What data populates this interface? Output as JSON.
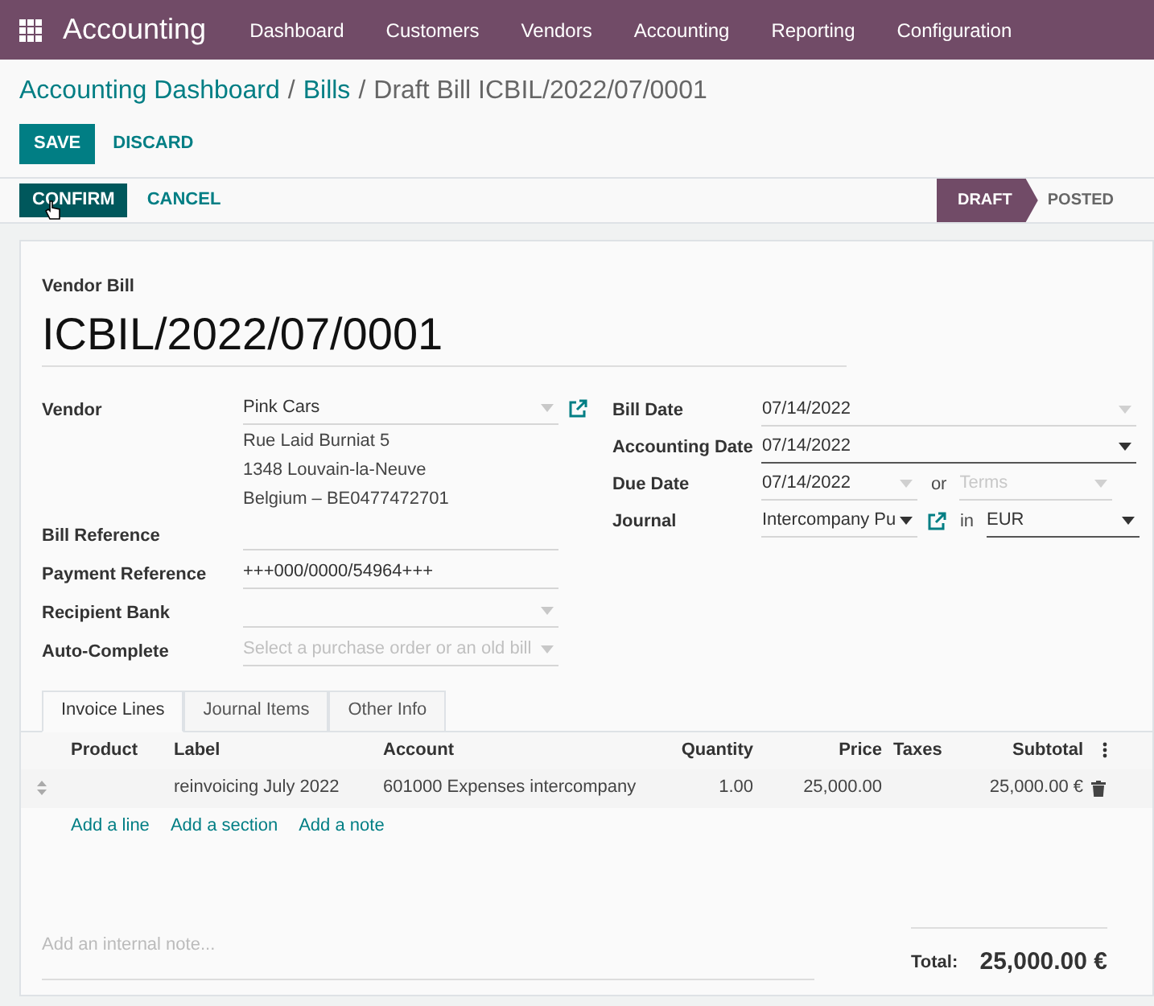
{
  "navbar": {
    "app": "Accounting",
    "menu": [
      "Dashboard",
      "Customers",
      "Vendors",
      "Accounting",
      "Reporting",
      "Configuration"
    ]
  },
  "breadcrumb": [
    {
      "label": "Accounting Dashboard",
      "link": true
    },
    {
      "label": "Bills",
      "link": true,
      "separator": "/"
    },
    {
      "label": "Draft Bill ICBIL/2022/07/0001",
      "link": false,
      "separator": "/"
    }
  ],
  "edit_buttons": [
    {
      "label": "SAVE",
      "kind": "primary"
    },
    {
      "label": "DISCARD",
      "kind": "link"
    }
  ],
  "action_buttons": [
    {
      "label": "CONFIRM",
      "kind": "primary"
    },
    {
      "label": "CANCEL",
      "kind": "link"
    }
  ],
  "statusbar": [
    {
      "label": "DRAFT",
      "selected": true
    },
    {
      "label": "POSTED",
      "selected": false
    }
  ],
  "form": {
    "subtitle": "Vendor Bill",
    "name": "ICBIL/2022/07/0001",
    "left_fields": [
      {
        "label": "Vendor",
        "kind": "many2one",
        "value": "Pink Cars",
        "external_link": true,
        "address": [
          "Rue Laid Burniat 5",
          "1348 Louvain-la-Neuve",
          "Belgium – BE0477472701"
        ]
      },
      {
        "label": "Bill Reference",
        "kind": "text"
      },
      {
        "label": "Payment Reference",
        "kind": "text",
        "value": "+++000/0000/54964+++"
      },
      {
        "label": "Recipient Bank",
        "kind": "many2one"
      },
      {
        "label": "Auto-Complete",
        "kind": "many2one",
        "placeholder": "Select a purchase order or an old bill"
      }
    ],
    "right_fields": [
      {
        "label": "Bill Date",
        "kind": "date",
        "value": "07/14/2022",
        "focused": false
      },
      {
        "label": "Accounting Date",
        "kind": "date",
        "value": "07/14/2022",
        "focused": true
      },
      {
        "label": "Due Date",
        "kind": "due",
        "value": "07/14/2022",
        "separator": "or",
        "placeholder": "Terms"
      },
      {
        "label": "Journal",
        "kind": "journal",
        "value": "Intercompany Pu",
        "separator": "in",
        "currency": "EUR"
      }
    ]
  },
  "tabs": [
    {
      "label": "Invoice Lines",
      "selected": true
    },
    {
      "label": "Journal Items",
      "selected": false
    },
    {
      "label": "Other Info",
      "selected": false
    }
  ],
  "table": {
    "columns": [
      "Product",
      "Label",
      "Account",
      "Quantity",
      "Price",
      "Taxes",
      "Subtotal"
    ],
    "rows": [
      [
        "",
        "reinvoicing July 2022",
        "601000 Expenses intercompany",
        "1.00",
        "25,000.00",
        "",
        "25,000.00 €"
      ]
    ],
    "add_links": [
      "Add a line",
      "Add a section",
      "Add a note"
    ]
  },
  "note_placeholder": "Add an internal note...",
  "total": {
    "label": "Total:",
    "value": "25,000.00 €"
  }
}
